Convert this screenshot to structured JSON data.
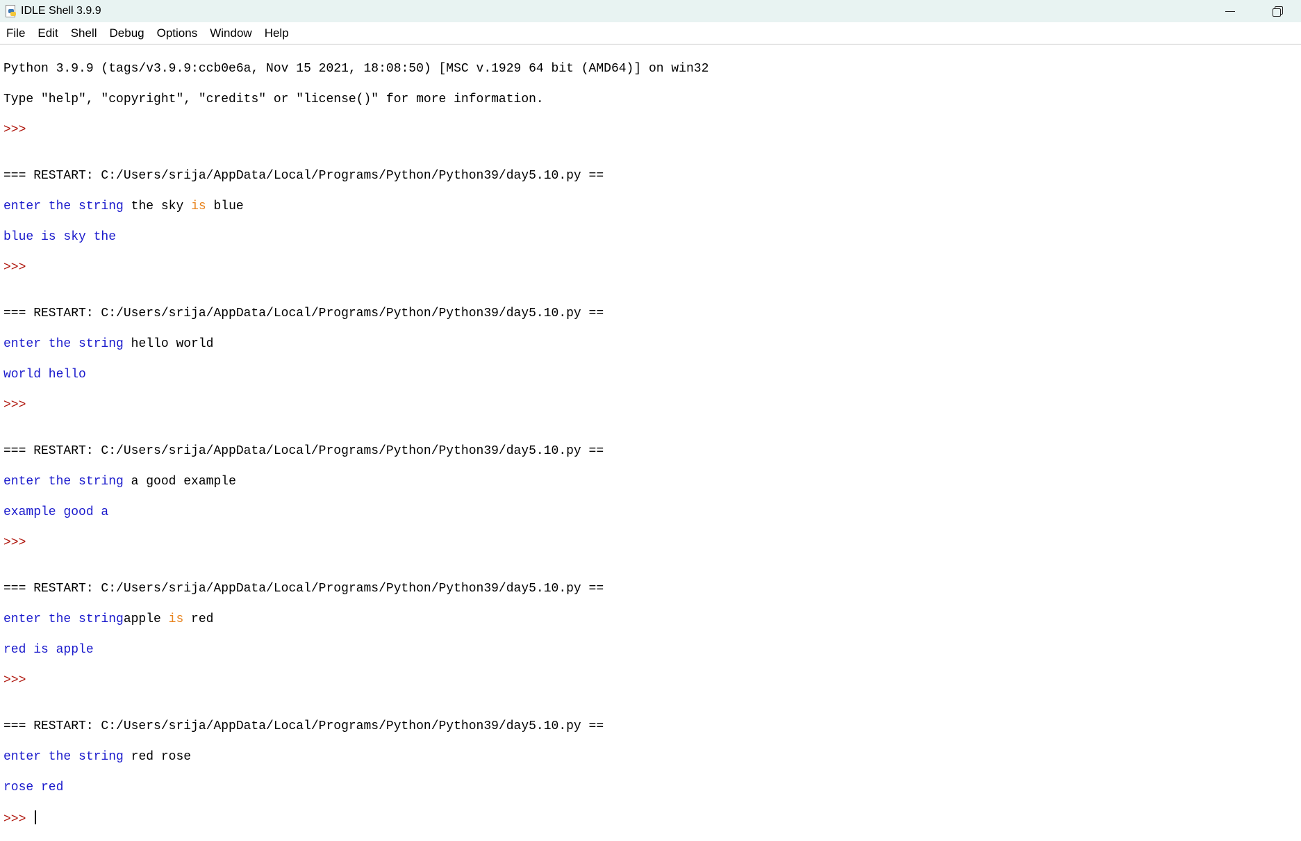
{
  "window": {
    "title": "IDLE Shell 3.9.9",
    "icon": "python-idle-icon",
    "controls": [
      "minimize-icon",
      "restore-icon"
    ]
  },
  "menu": {
    "items": [
      "File",
      "Edit",
      "Shell",
      "Debug",
      "Options",
      "Window",
      "Help"
    ]
  },
  "colors": {
    "stdout": "#1a1acc",
    "prompt": "#b0180f",
    "keyword": "#e8841e",
    "titlebar": "#e8f3f2"
  },
  "shell": {
    "banner1": "Python 3.9.9 (tags/v3.9.9:ccb0e6a, Nov 15 2021, 18:08:50) [MSC v.1929 64 bit (AMD64)] on win32",
    "banner2": "Type \"help\", \"copyright\", \"credits\" or \"license()\" for more information.",
    "prompt": ">>>",
    "prompt_final": ">>> ",
    "restart": "=== RESTART: C:/Users/srija/AppData/Local/Programs/Python/Python39/day5.10.py ==",
    "runs": [
      {
        "prompt_text": "enter the string ",
        "input_a": "the sky ",
        "input_kw": "is",
        "input_b": " blue",
        "output": "blue is sky the"
      },
      {
        "prompt_text": "enter the string ",
        "input_a": "hello world",
        "input_kw": "",
        "input_b": "",
        "output": "world hello"
      },
      {
        "prompt_text": "enter the string ",
        "input_a": "a good example",
        "input_kw": "",
        "input_b": "",
        "output": "example good a"
      },
      {
        "prompt_text": "enter the string",
        "input_a": "apple ",
        "input_kw": "is",
        "input_b": " red",
        "output": "red is apple"
      },
      {
        "prompt_text": "enter the string ",
        "input_a": "red rose",
        "input_kw": "",
        "input_b": "",
        "output": "rose red"
      }
    ]
  }
}
